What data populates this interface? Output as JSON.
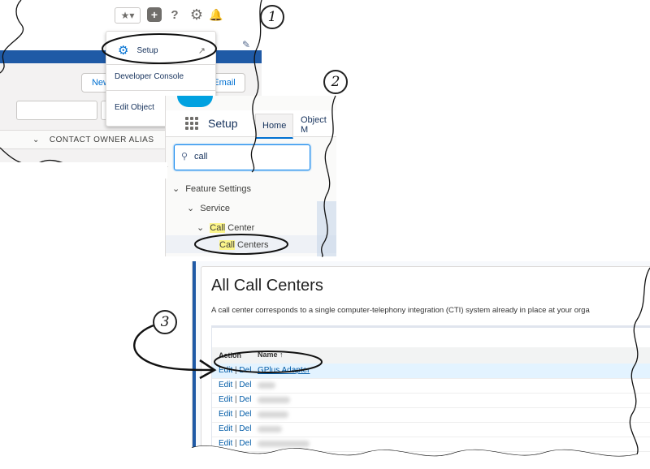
{
  "callouts": [
    "1",
    "2",
    "3"
  ],
  "panel1": {
    "header_icons": [
      "star-icon",
      "plus-icon",
      "help-icon",
      "gear-icon",
      "bell-icon",
      "avatar"
    ],
    "menu": {
      "setup": "Setup",
      "developer_console": "Developer Console",
      "edit_object": "Edit Object"
    },
    "buttons": {
      "new": "New",
      "email": "Email"
    },
    "column_header": "CONTACT OWNER ALIAS"
  },
  "panel2": {
    "title": "Setup",
    "tabs": [
      "Home",
      "Object M"
    ],
    "search_value": "call",
    "tree": {
      "feature_settings": "Feature Settings",
      "service": "Service",
      "call_center_hl": "Call",
      "call_center_rest": " Center",
      "call_centers_hl": "Call",
      "call_centers_rest": " Centers"
    }
  },
  "panel3": {
    "title": "All Call Centers",
    "description": "A call center corresponds to a single computer-telephony integration (CTI) system already in place at your orga",
    "columns": {
      "action": "Action",
      "name": "Name ↑"
    },
    "rows": [
      {
        "edit": "Edit",
        "sep": "|",
        "del": "Del",
        "name": "GPlus Adapter"
      },
      {
        "edit": "Edit",
        "sep": "|",
        "del": "Del",
        "name": ""
      },
      {
        "edit": "Edit",
        "sep": "|",
        "del": "Del",
        "name": ""
      },
      {
        "edit": "Edit",
        "sep": "|",
        "del": "Del",
        "name": ""
      },
      {
        "edit": "Edit",
        "sep": "|",
        "del": "Del",
        "name": ""
      },
      {
        "edit": "Edit",
        "sep": "|",
        "del": "Del",
        "name": ""
      }
    ]
  },
  "colors": {
    "brand_blue": "#1f5aa6",
    "link": "#015ba7",
    "highlight": "#fcf58a",
    "selected_row": "#e3f3ff"
  }
}
